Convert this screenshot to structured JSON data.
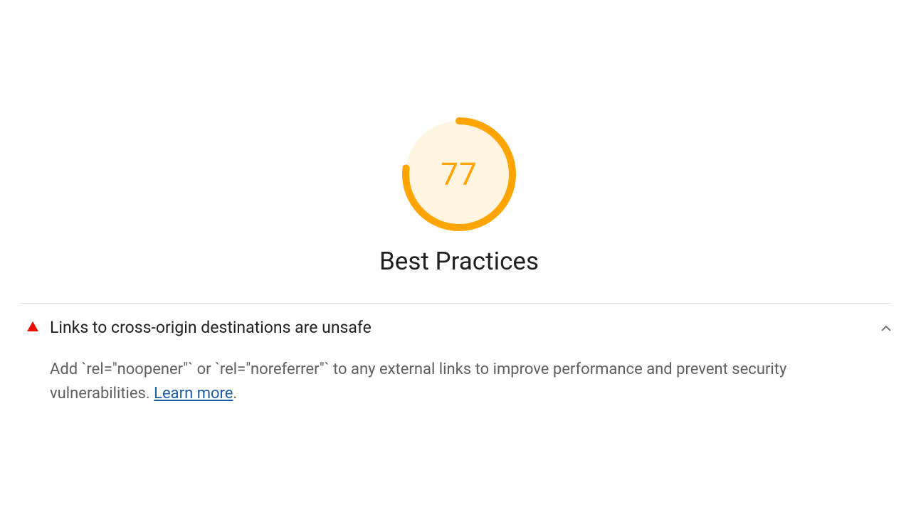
{
  "score": {
    "value": 77,
    "category": "Best Practices",
    "arc_dasharray": "362 471",
    "color": "#FFA400",
    "fill": "#FFF5E0"
  },
  "audit": {
    "title": "Links to cross-origin destinations are unsafe",
    "description_prefix": "Add `rel=\"noopener\"` or `rel=\"noreferrer\"` to any external links to improve performance and prevent security vulnerabilities. ",
    "learn_more": "Learn more",
    "description_suffix": "."
  }
}
